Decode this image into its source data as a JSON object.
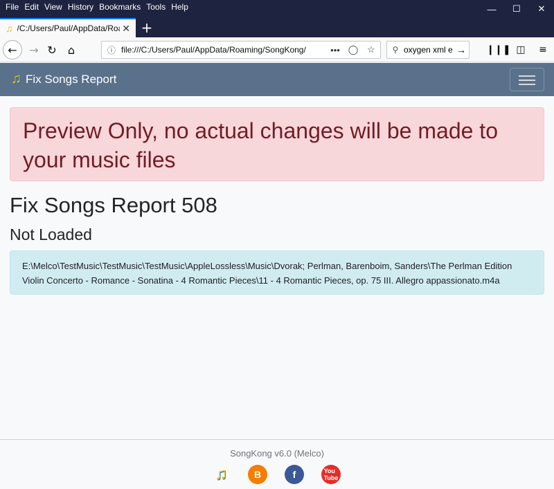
{
  "browser": {
    "menu": [
      "File",
      "Edit",
      "View",
      "History",
      "Bookmarks",
      "Tools",
      "Help"
    ],
    "tab_title": "/C:/Users/Paul/AppData/Roaming/SongKong/Fix",
    "url": "file:///C:/Users/Paul/AppData/Roaming/SongKong/",
    "search_query": "oxygen xml e"
  },
  "app": {
    "brand": "Fix Songs Report"
  },
  "content": {
    "warning": "Preview Only, no actual changes will be made to your music files",
    "title": "Fix Songs Report 508",
    "subtitle": "Not Loaded",
    "path": "E:\\Melco\\TestMusic\\TestMusic\\TestMusic\\AppleLossless\\Music\\Dvorak; Perlman, Barenboim, Sanders\\The Perlman Edition Violin Concerto - Romance - Sonatina - 4 Romantic Pieces\\11 - 4 Romantic Pieces, op. 75 III. Allegro appassionato.m4a"
  },
  "footer": {
    "version": "SongKong v6.0 (Melco)",
    "icons": [
      "songkong-icon",
      "blogger-icon",
      "facebook-icon",
      "youtube-icon"
    ]
  },
  "colors": {
    "navbar": "#5a718b",
    "danger_bg": "#f8d7da",
    "info_bg": "#d1ecf1"
  }
}
